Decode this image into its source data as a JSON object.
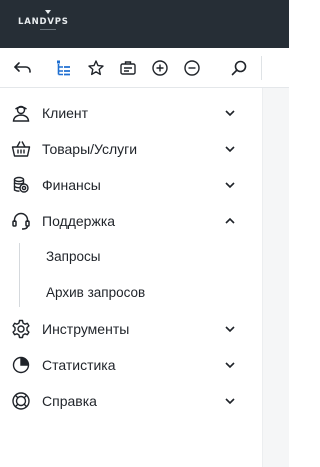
{
  "brand": {
    "logo_text": "LANDVPS"
  },
  "toolbar": {
    "buttons": [
      {
        "name": "back-icon"
      },
      {
        "name": "tree-icon"
      },
      {
        "name": "star-icon"
      },
      {
        "name": "briefcase-icon"
      },
      {
        "name": "plus-circle-icon"
      },
      {
        "name": "minus-circle-icon"
      },
      {
        "name": "search-icon"
      }
    ],
    "accent": "#1f6fd1"
  },
  "menu": {
    "items": [
      {
        "label": "Клиент",
        "icon": "user-icon",
        "expanded": false
      },
      {
        "label": "Товары/Услуги",
        "icon": "basket-icon",
        "expanded": false
      },
      {
        "label": "Финансы",
        "icon": "coins-icon",
        "expanded": false
      },
      {
        "label": "Поддержка",
        "icon": "headset-icon",
        "expanded": true,
        "children": [
          {
            "label": "Запросы"
          },
          {
            "label": "Архив запросов"
          }
        ]
      },
      {
        "label": "Инструменты",
        "icon": "gear-icon",
        "expanded": false
      },
      {
        "label": "Статистика",
        "icon": "pie-chart-icon",
        "expanded": false
      },
      {
        "label": "Справка",
        "icon": "lifebuoy-icon",
        "expanded": false
      }
    ]
  }
}
